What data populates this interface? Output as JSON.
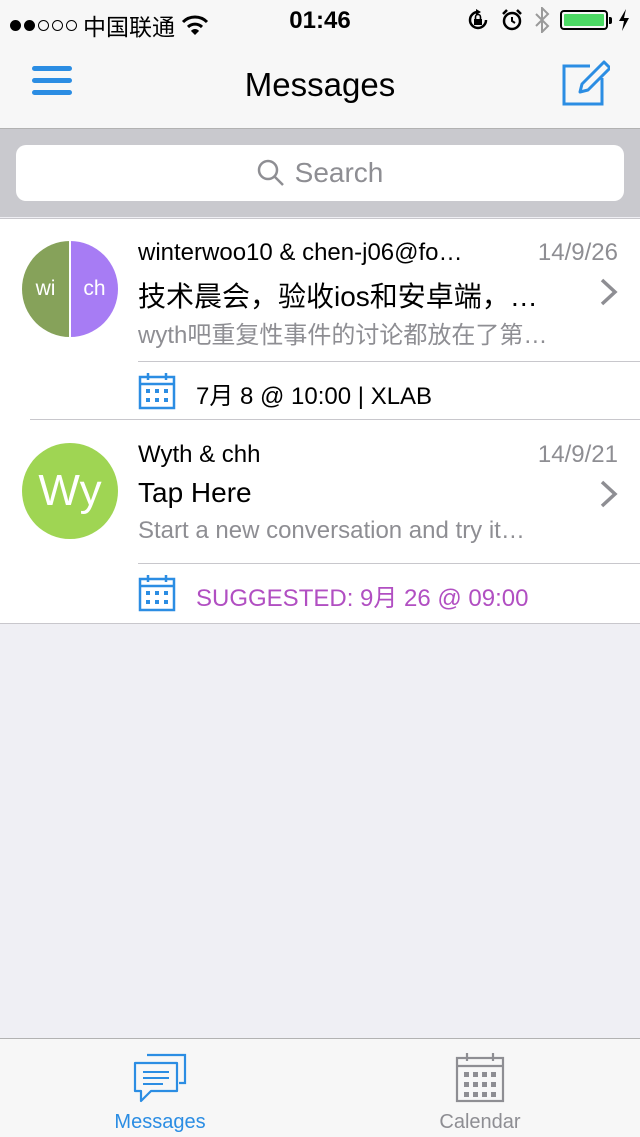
{
  "status_bar": {
    "carrier": "中国联通",
    "time": "01:46"
  },
  "nav": {
    "title": "Messages"
  },
  "search": {
    "placeholder": "Search"
  },
  "conversations": [
    {
      "avatar_left": "wi",
      "avatar_right": "ch",
      "participants": "winterwoo10 & chen-j06@fo…",
      "date": "14/9/26",
      "subject": "技术晨会，验收ios和安卓端，…",
      "preview": "wyth吧重复性事件的讨论都放在了第…",
      "event_text": "7月 8 @ 10:00  |  XLAB"
    },
    {
      "avatar_initials": "Wy",
      "participants": "Wyth & chh",
      "date": "14/9/21",
      "subject": "Tap Here",
      "preview": "Start a new conversation and try it…",
      "event_text": "SUGGESTED: 9月 26 @ 09:00"
    }
  ],
  "tabs": [
    {
      "label": "Messages",
      "active": true
    },
    {
      "label": "Calendar",
      "active": false
    }
  ],
  "colors": {
    "accent": "#2b8de3",
    "suggested": "#b14fc2",
    "avatar_green": "#86a25a",
    "avatar_purple": "#a77cf4",
    "avatar_lime": "#9fd553"
  }
}
